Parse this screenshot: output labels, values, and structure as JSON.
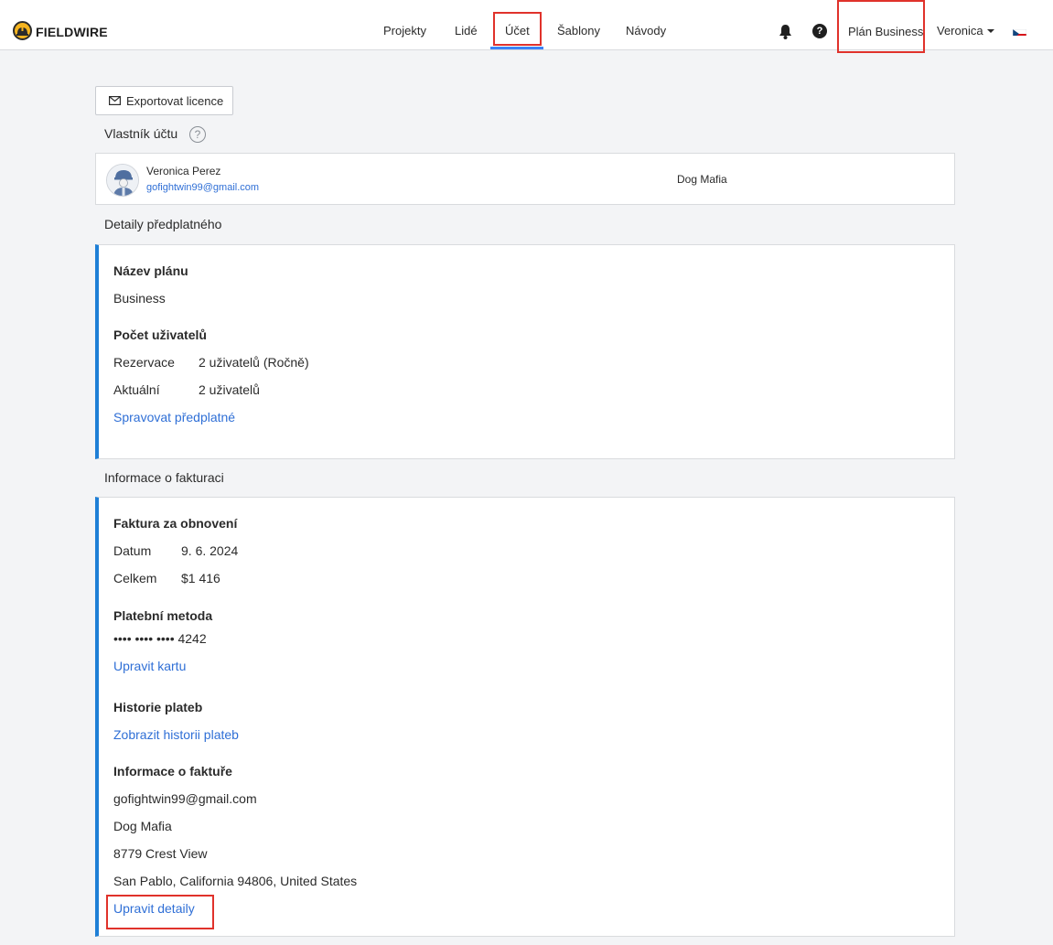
{
  "header": {
    "logo_text": "FIELDWIRE",
    "nav": [
      "Projekty",
      "Lidé",
      "Účet",
      "Šablony",
      "Návody"
    ],
    "active_nav": "Účet",
    "plan_label": "Plán Business",
    "user_name": "Veronica",
    "language_flag": "czech-flag"
  },
  "toolbar": {
    "export_label": "Exportovat licence"
  },
  "owner": {
    "section_title": "Vlastník účtu",
    "help_glyph": "?",
    "name": "Veronica Perez",
    "email": "gofightwin99@gmail.com",
    "company": "Dog Mafia"
  },
  "subscription": {
    "section_title": "Detaily předplatného",
    "plan_heading": "Název plánu",
    "plan_value": "Business",
    "users_heading": "Počet uživatelů",
    "reserved_label": "Rezervace",
    "reserved_value": "2 uživatelů (Ročně)",
    "current_label": "Aktuální",
    "current_value": "2 uživatelů",
    "manage_link": "Spravovat předplatné"
  },
  "billing": {
    "section_title": "Informace o fakturaci",
    "renewal_heading": "Faktura za obnovení",
    "date_label": "Datum",
    "date_value": "9. 6. 2024",
    "total_label": "Celkem",
    "total_value": "$1 416",
    "payment_heading": "Platební metoda",
    "card_number": "•••• •••• •••• 4242",
    "edit_card_link": "Upravit kartu",
    "history_heading": "Historie plateb",
    "history_link": "Zobrazit historii plateb",
    "invoice_heading": "Informace o faktuře",
    "invoice_email": "gofightwin99@gmail.com",
    "invoice_company": "Dog Mafia",
    "invoice_street": "8779 Crest View",
    "invoice_city": "San Pablo, California 94806, United States",
    "edit_details_link": "Upravit detaily"
  },
  "colors": {
    "accent": "#1e7fd6",
    "link": "#2f6fd6",
    "highlight": "#e0322b",
    "background": "#f3f4f6"
  }
}
